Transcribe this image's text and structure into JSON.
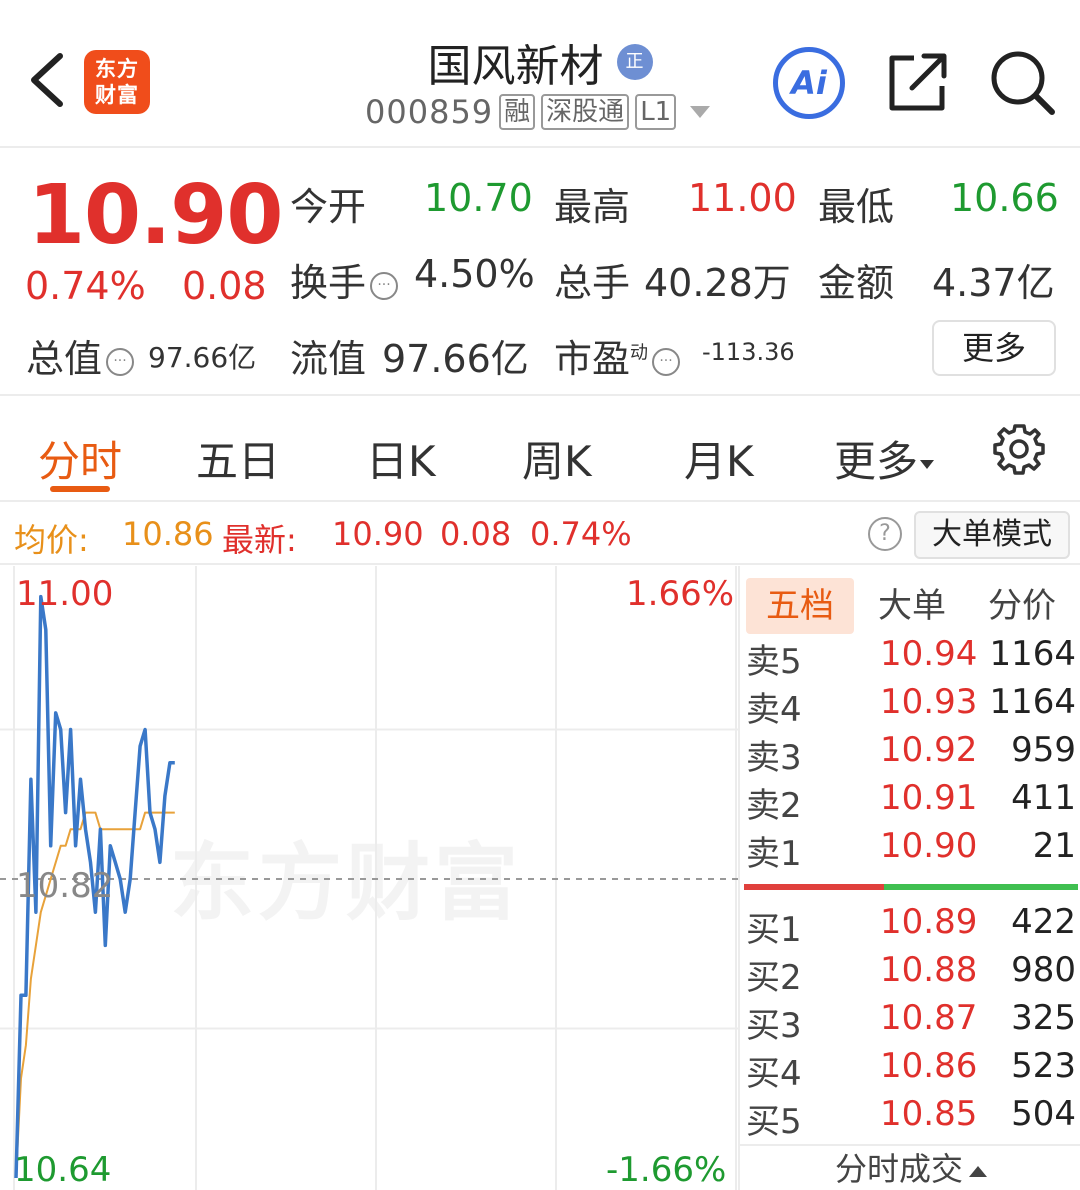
{
  "header": {
    "stock_name": "国风新材",
    "zheng_badge": "正",
    "code": "000859",
    "tags": [
      "融",
      "深股通",
      "L1"
    ],
    "logo_text_line1": "东方",
    "logo_text_line2": "财富",
    "ai_label": "Ai"
  },
  "quote": {
    "price": "10.90",
    "change_pct": "0.74%",
    "change_abs": "0.08",
    "open_label": "今开",
    "open_value": "10.70",
    "high_label": "最高",
    "high_value": "11.00",
    "low_label": "最低",
    "low_value": "10.66",
    "turnover_label": "换手",
    "turnover_value": "4.50%",
    "volume_label": "总手",
    "volume_value": "40.28万",
    "amount_label": "金额",
    "amount_value": "4.37亿",
    "mktcap_label": "总值",
    "mktcap_value": "97.66亿",
    "float_label": "流值",
    "float_value": "97.66亿",
    "pe_label": "市盈",
    "pe_super": "动",
    "pe_value": "-113.36",
    "more_label": "更多"
  },
  "tabs": {
    "items": [
      "分时",
      "五日",
      "日K",
      "周K",
      "月K",
      "更多"
    ],
    "active_index": 0
  },
  "infobar": {
    "avg_label": "均价:",
    "avg_value": "10.86",
    "latest_label": "最新:",
    "latest_value": "10.90",
    "latest_change": "0.08",
    "latest_pct": "0.74%",
    "help": "?",
    "big_mode": "大单模式"
  },
  "chart": {
    "top_price": "11.00",
    "top_pct": "1.66%",
    "mid_price": "10.82",
    "bottom_price": "10.64",
    "bottom_pct": "-1.66%",
    "watermark": "东方财富",
    "colors": {
      "price_line": "#3a78c8",
      "avg_line": "#e8a23a",
      "up": "#e0302c",
      "down": "#1e9a30"
    }
  },
  "chart_data": {
    "type": "line",
    "title": "",
    "ylim": [
      10.64,
      11.0
    ],
    "prev_close": 10.82,
    "series": [
      {
        "name": "",
        "values": [
          10.64,
          10.75,
          10.75,
          10.88,
          10.8,
          10.99,
          10.97,
          10.84,
          10.92,
          10.91,
          10.86,
          10.91,
          10.84,
          10.88,
          10.85,
          10.83,
          10.8,
          10.85,
          10.78,
          10.84,
          10.83,
          10.82,
          10.8,
          10.82,
          10.86,
          10.9,
          10.91,
          10.86,
          10.85,
          10.83,
          10.87,
          10.89,
          10.89
        ]
      },
      {
        "name": "",
        "values": [
          10.64,
          10.7,
          10.72,
          10.76,
          10.78,
          10.8,
          10.81,
          10.82,
          10.83,
          10.84,
          10.84,
          10.85,
          10.85,
          10.85,
          10.86,
          10.86,
          10.86,
          10.85,
          10.85,
          10.85,
          10.85,
          10.85,
          10.85,
          10.85,
          10.85,
          10.85,
          10.86,
          10.86,
          10.86,
          10.86,
          10.86,
          10.86,
          10.86
        ]
      }
    ]
  },
  "order_book": {
    "tabs": [
      "五档",
      "大单",
      "分价"
    ],
    "sells": [
      {
        "label": "卖5",
        "price": "10.94",
        "vol": "1164"
      },
      {
        "label": "卖4",
        "price": "10.93",
        "vol": "1164"
      },
      {
        "label": "卖3",
        "price": "10.92",
        "vol": "959"
      },
      {
        "label": "卖2",
        "price": "10.91",
        "vol": "411"
      },
      {
        "label": "卖1",
        "price": "10.90",
        "vol": "21"
      }
    ],
    "buys": [
      {
        "label": "买1",
        "price": "10.89",
        "vol": "422"
      },
      {
        "label": "买2",
        "price": "10.88",
        "vol": "980"
      },
      {
        "label": "买3",
        "price": "10.87",
        "vol": "325"
      },
      {
        "label": "买4",
        "price": "10.86",
        "vol": "523"
      },
      {
        "label": "买5",
        "price": "10.85",
        "vol": "504"
      }
    ],
    "ticks_label": "分时成交"
  }
}
